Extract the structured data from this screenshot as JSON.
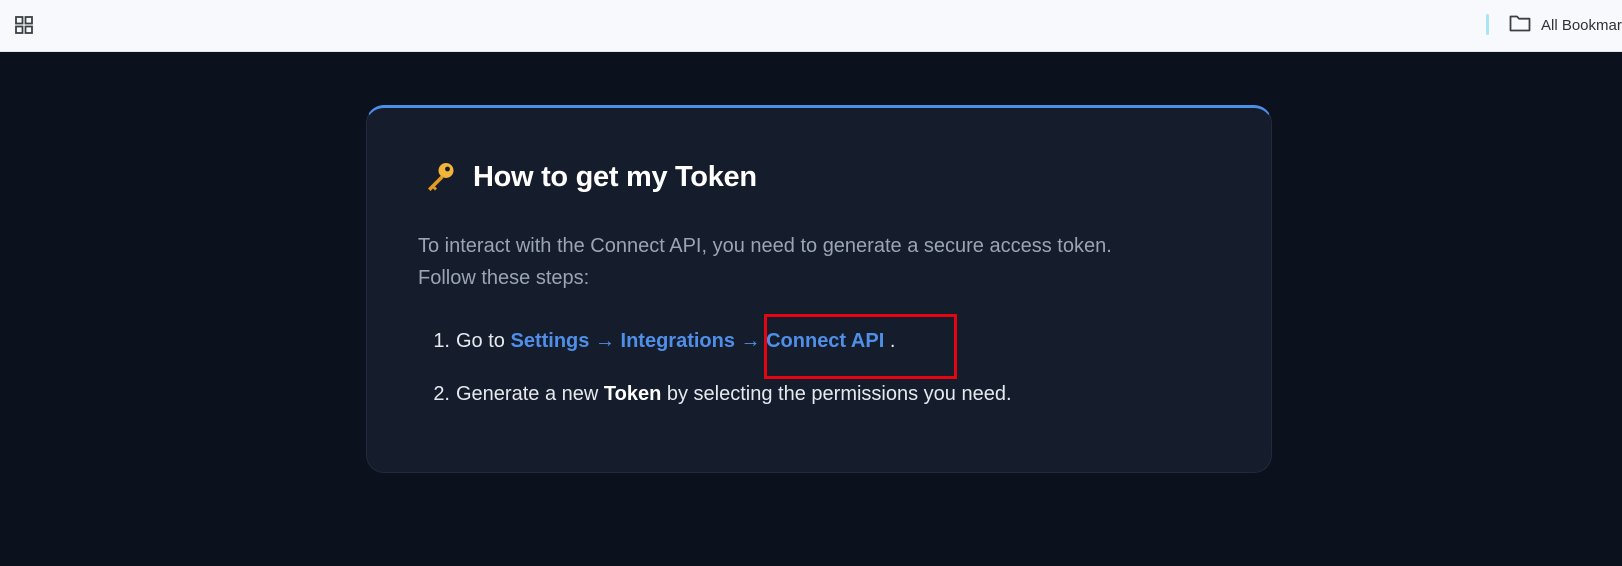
{
  "bookmarks_bar": {
    "apps_icon": "grid-icon",
    "all_bookmarks_label": "All Bookmar",
    "folder_icon": "folder-icon"
  },
  "card": {
    "accent_color": "#4d8ee8",
    "key_icon": "key-icon",
    "title": "How to get my Token",
    "intro_line1": "To interact with the Connect API, you need to generate a secure access token.",
    "intro_line2": "Follow these steps:",
    "steps": [
      {
        "number": "1.",
        "prefix": "Go to",
        "link1": "Settings",
        "arrow1": "→",
        "link2": "Integrations",
        "arrow2": "→",
        "link3": "Connect API",
        "suffix": "."
      },
      {
        "number": "2.",
        "prefix": "Generate a new",
        "bold": "Token",
        "suffix": "by selecting the permissions you need."
      }
    ]
  },
  "highlight_color": "#e3050f"
}
